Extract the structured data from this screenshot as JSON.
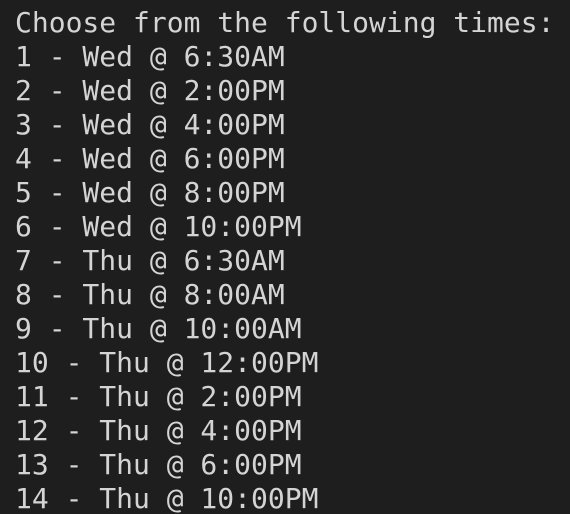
{
  "terminal": {
    "lines": [
      "Choose from the following times:",
      "1 - Wed @ 6:30AM",
      "2 - Wed @ 2:00PM",
      "3 - Wed @ 4:00PM",
      "4 - Wed @ 6:00PM",
      "5 - Wed @ 8:00PM",
      "6 - Wed @ 10:00PM",
      "7 - Thu @ 6:30AM",
      "8 - Thu @ 8:00AM",
      "9 - Thu @ 10:00AM",
      "10 - Thu @ 12:00PM",
      "11 - Thu @ 2:00PM",
      "12 - Thu @ 4:00PM",
      "13 - Thu @ 6:00PM",
      "14 - Thu @ 10:00PM"
    ],
    "colors": {
      "background": "#1e1e1e",
      "text": "#d4d4d4"
    }
  }
}
